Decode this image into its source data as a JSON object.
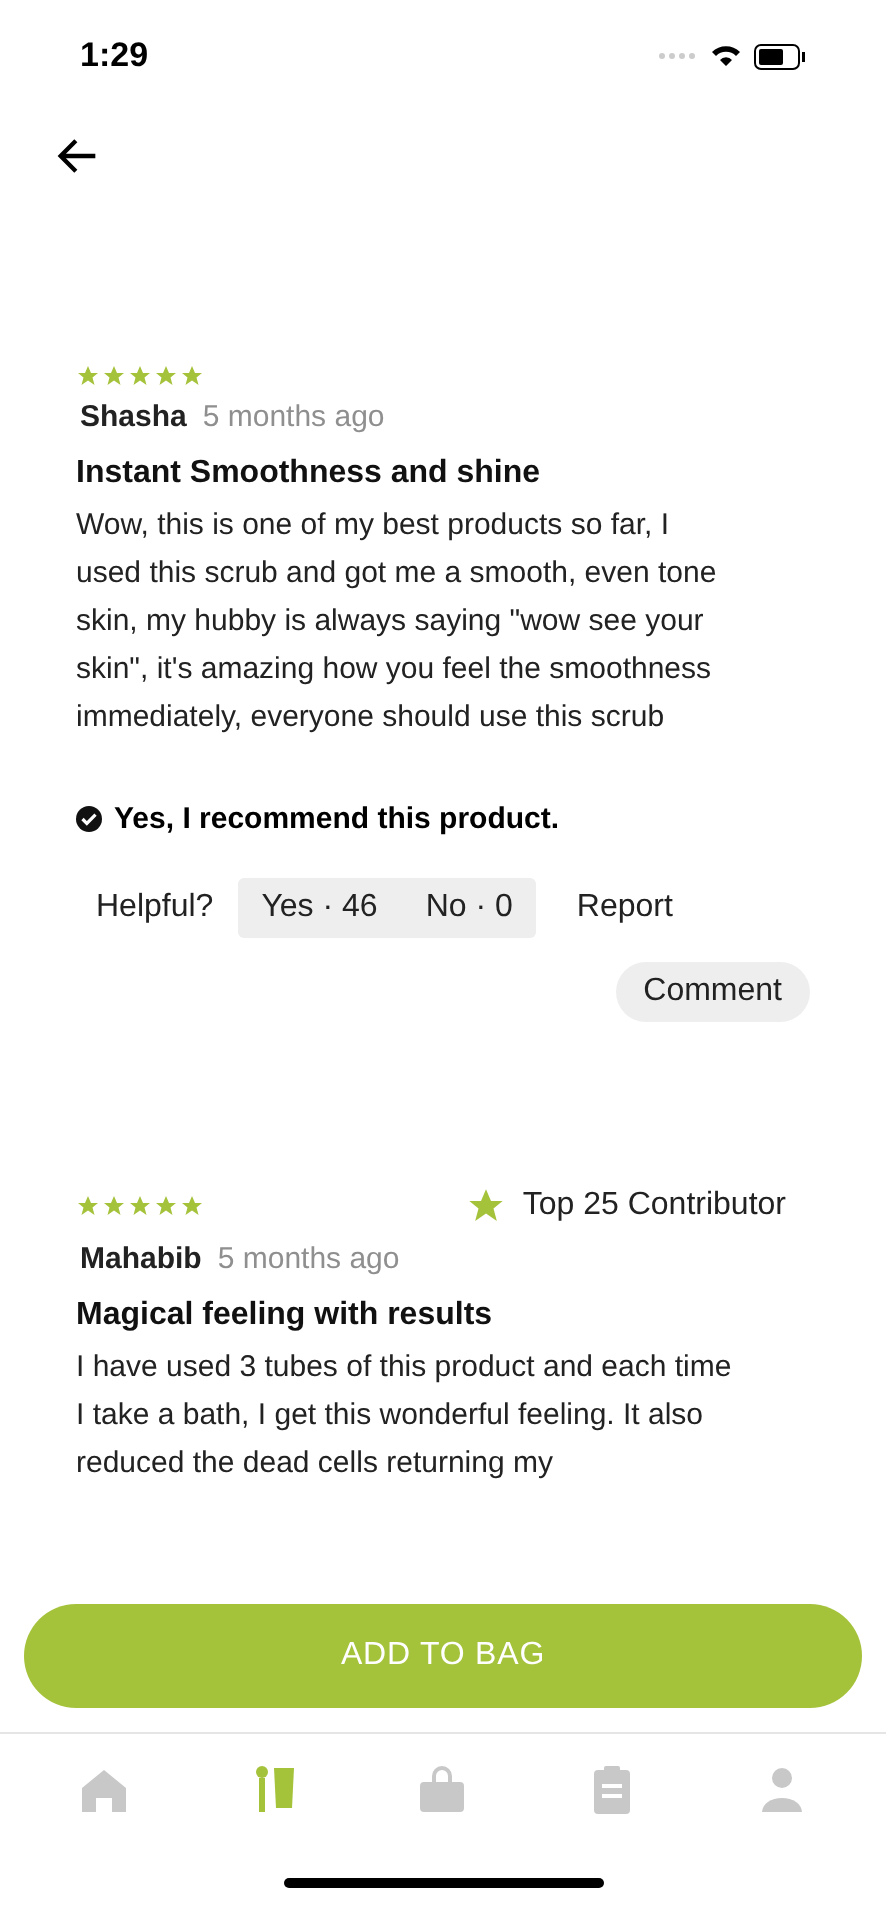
{
  "status_bar": {
    "time": "1:29"
  },
  "reviews": [
    {
      "stars": 5,
      "author": "Shasha",
      "time": "5 months ago",
      "title": "Instant Smoothness and shine",
      "body": "Wow, this is one of my best products so far, I used this scrub and got me a smooth, even tone skin, my hubby is always saying \"wow see your skin\", it's amazing how you feel the smoothness immediately, everyone should use this scrub",
      "recommend": "Yes,  I recommend this product.",
      "helpful_label": "Helpful?",
      "yes_vote": "Yes · 46",
      "no_vote": "No · 0",
      "report": "Report",
      "comment": "Comment"
    },
    {
      "stars": 5,
      "badge": "Top 25 Contributor",
      "author": "Mahabib",
      "time": "5 months ago",
      "title": "Magical feeling with results",
      "body": "I have used 3 tubes of this product and each time I take a bath, I get this wonderful feeling. It also reduced the dead cells returning my"
    }
  ],
  "add_button": "ADD TO BAG",
  "tab_bar": [
    {
      "kind": "home",
      "selected": false
    },
    {
      "kind": "products",
      "selected": true
    },
    {
      "kind": "bag",
      "selected": false
    },
    {
      "kind": "orders",
      "selected": false
    },
    {
      "kind": "profile",
      "selected": false
    }
  ]
}
